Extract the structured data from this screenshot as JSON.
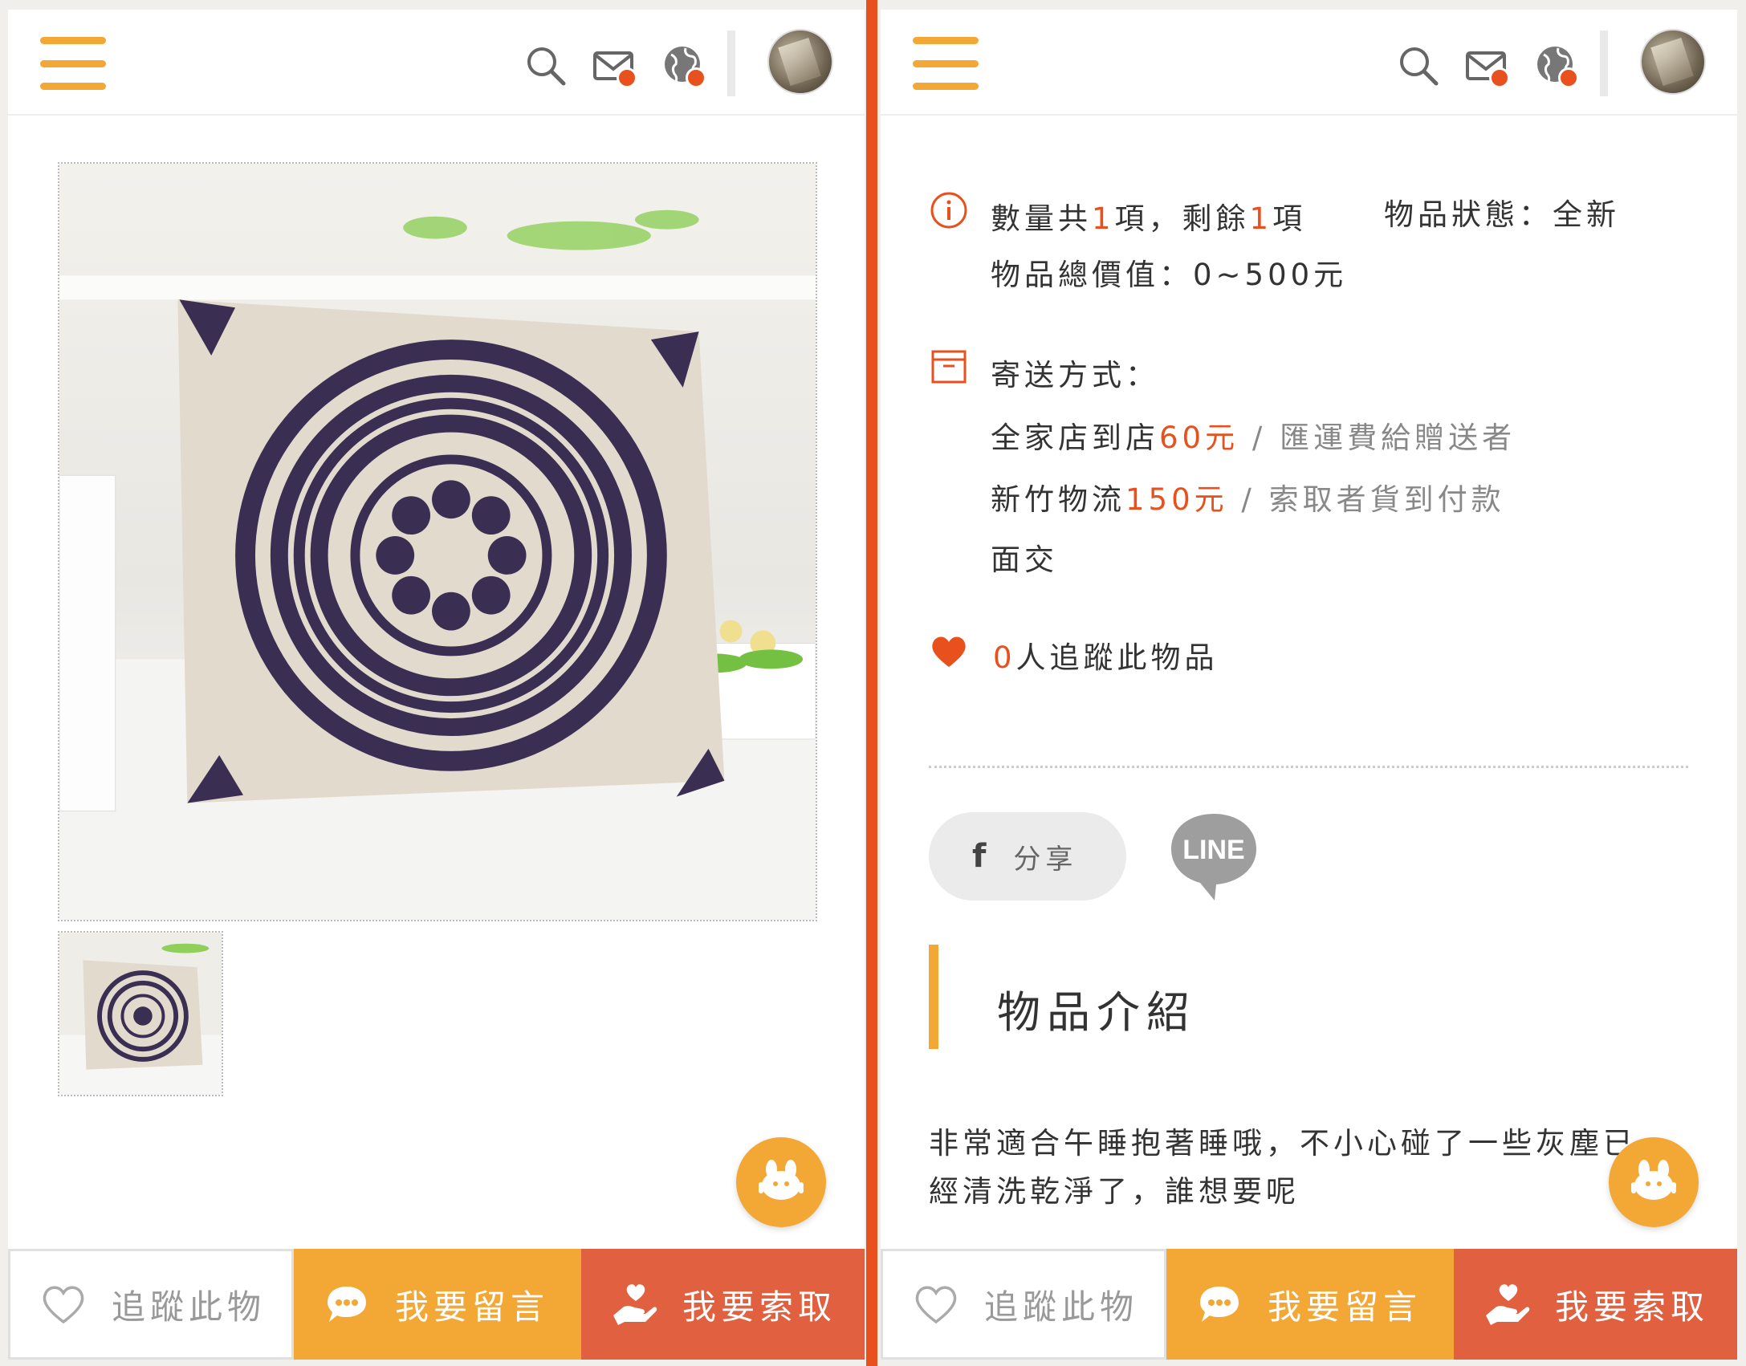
{
  "colors": {
    "accent_orange": "#f3a735",
    "accent_red": "#e8501d",
    "take_button": "#e0603f"
  },
  "header": {
    "icons": [
      "menu-icon",
      "search-icon",
      "mail-icon",
      "globe-icon",
      "avatar"
    ]
  },
  "bottom_bar": {
    "follow_label": "追蹤此物",
    "message_label": "我要留言",
    "take_label": "我要索取"
  },
  "item": {
    "quantity_prefix": "數量共",
    "quantity_total": "1",
    "quantity_mid": "項，剩餘",
    "quantity_remaining": "1",
    "quantity_suffix": "項",
    "condition": "物品狀態：全新",
    "total_value": "物品總價值：0~500元",
    "shipping_title": "寄送方式：",
    "shipping": [
      {
        "method": "全家店到店",
        "price": "60元",
        "sep": " / ",
        "note": "匯運費給贈送者"
      },
      {
        "method": "新竹物流",
        "price": "150元",
        "sep": " / ",
        "note": "索取者貨到付款"
      },
      {
        "method": "面交",
        "price": "",
        "sep": "",
        "note": ""
      }
    ],
    "followers_count": "0",
    "followers_label": "人追蹤此物品"
  },
  "share": {
    "facebook_icon_text": "f",
    "facebook_label": "分享",
    "line_label": "LINE"
  },
  "section": {
    "title": "物品介紹",
    "description_line1": "非常適合午睡抱著睡哦，不小心碰了一些灰塵已",
    "description_line2": "經清洗乾淨了，誰想要呢"
  }
}
